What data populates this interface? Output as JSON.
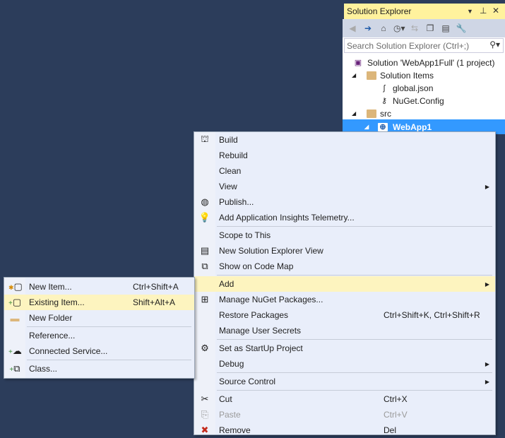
{
  "solution_explorer": {
    "title": "Solution Explorer",
    "search_placeholder": "Search Solution Explorer (Ctrl+;)",
    "tree": [
      {
        "label": "Solution 'WebApp1Full' (1 project)",
        "icon": "solution-icon"
      },
      {
        "label": "Solution Items",
        "icon": "folder-icon"
      },
      {
        "label": "global.json",
        "icon": "json-file-icon"
      },
      {
        "label": "NuGet.Config",
        "icon": "config-file-icon"
      },
      {
        "label": "src",
        "icon": "folder-icon"
      },
      {
        "label": "WebApp1",
        "icon": "web-project-icon",
        "selected": true
      }
    ]
  },
  "context_menu": {
    "items": [
      {
        "label": "Build",
        "icon": "build-icon"
      },
      {
        "label": "Rebuild"
      },
      {
        "label": "Clean"
      },
      {
        "label": "View",
        "submenu": true
      },
      {
        "label": "Publish...",
        "icon": "publish-icon"
      },
      {
        "label": "Add Application Insights Telemetry...",
        "icon": "insights-icon"
      },
      {
        "label": "Scope to This"
      },
      {
        "label": "New Solution Explorer View",
        "icon": "new-view-icon"
      },
      {
        "label": "Show on Code Map",
        "icon": "code-map-icon"
      },
      {
        "label": "Add",
        "submenu": true,
        "highlighted": true
      },
      {
        "label": "Manage NuGet Packages...",
        "icon": "nuget-icon"
      },
      {
        "label": "Restore Packages",
        "shortcut": "Ctrl+Shift+K, Ctrl+Shift+R"
      },
      {
        "label": "Manage User Secrets"
      },
      {
        "label": "Set as StartUp Project",
        "icon": "gear-icon"
      },
      {
        "label": "Debug",
        "submenu": true
      },
      {
        "label": "Source Control",
        "submenu": true
      },
      {
        "label": "Cut",
        "shortcut": "Ctrl+X",
        "icon": "scissors-icon"
      },
      {
        "label": "Paste",
        "shortcut": "Ctrl+V",
        "icon": "paste-icon",
        "disabled": true
      },
      {
        "label": "Remove",
        "shortcut": "Del",
        "icon": "remove-icon"
      }
    ]
  },
  "add_submenu": {
    "items": [
      {
        "label": "New Item...",
        "shortcut": "Ctrl+Shift+A"
      },
      {
        "label": "Existing Item...",
        "shortcut": "Shift+Alt+A"
      },
      {
        "label": "New Folder"
      },
      {
        "label": "Reference..."
      },
      {
        "label": "Connected Service..."
      },
      {
        "label": "Class..."
      }
    ]
  },
  "colors": {
    "background": "#2c3d5b",
    "highlight": "#fdf4bf",
    "selection": "#3399ff",
    "title_bar": "#fff29d"
  }
}
